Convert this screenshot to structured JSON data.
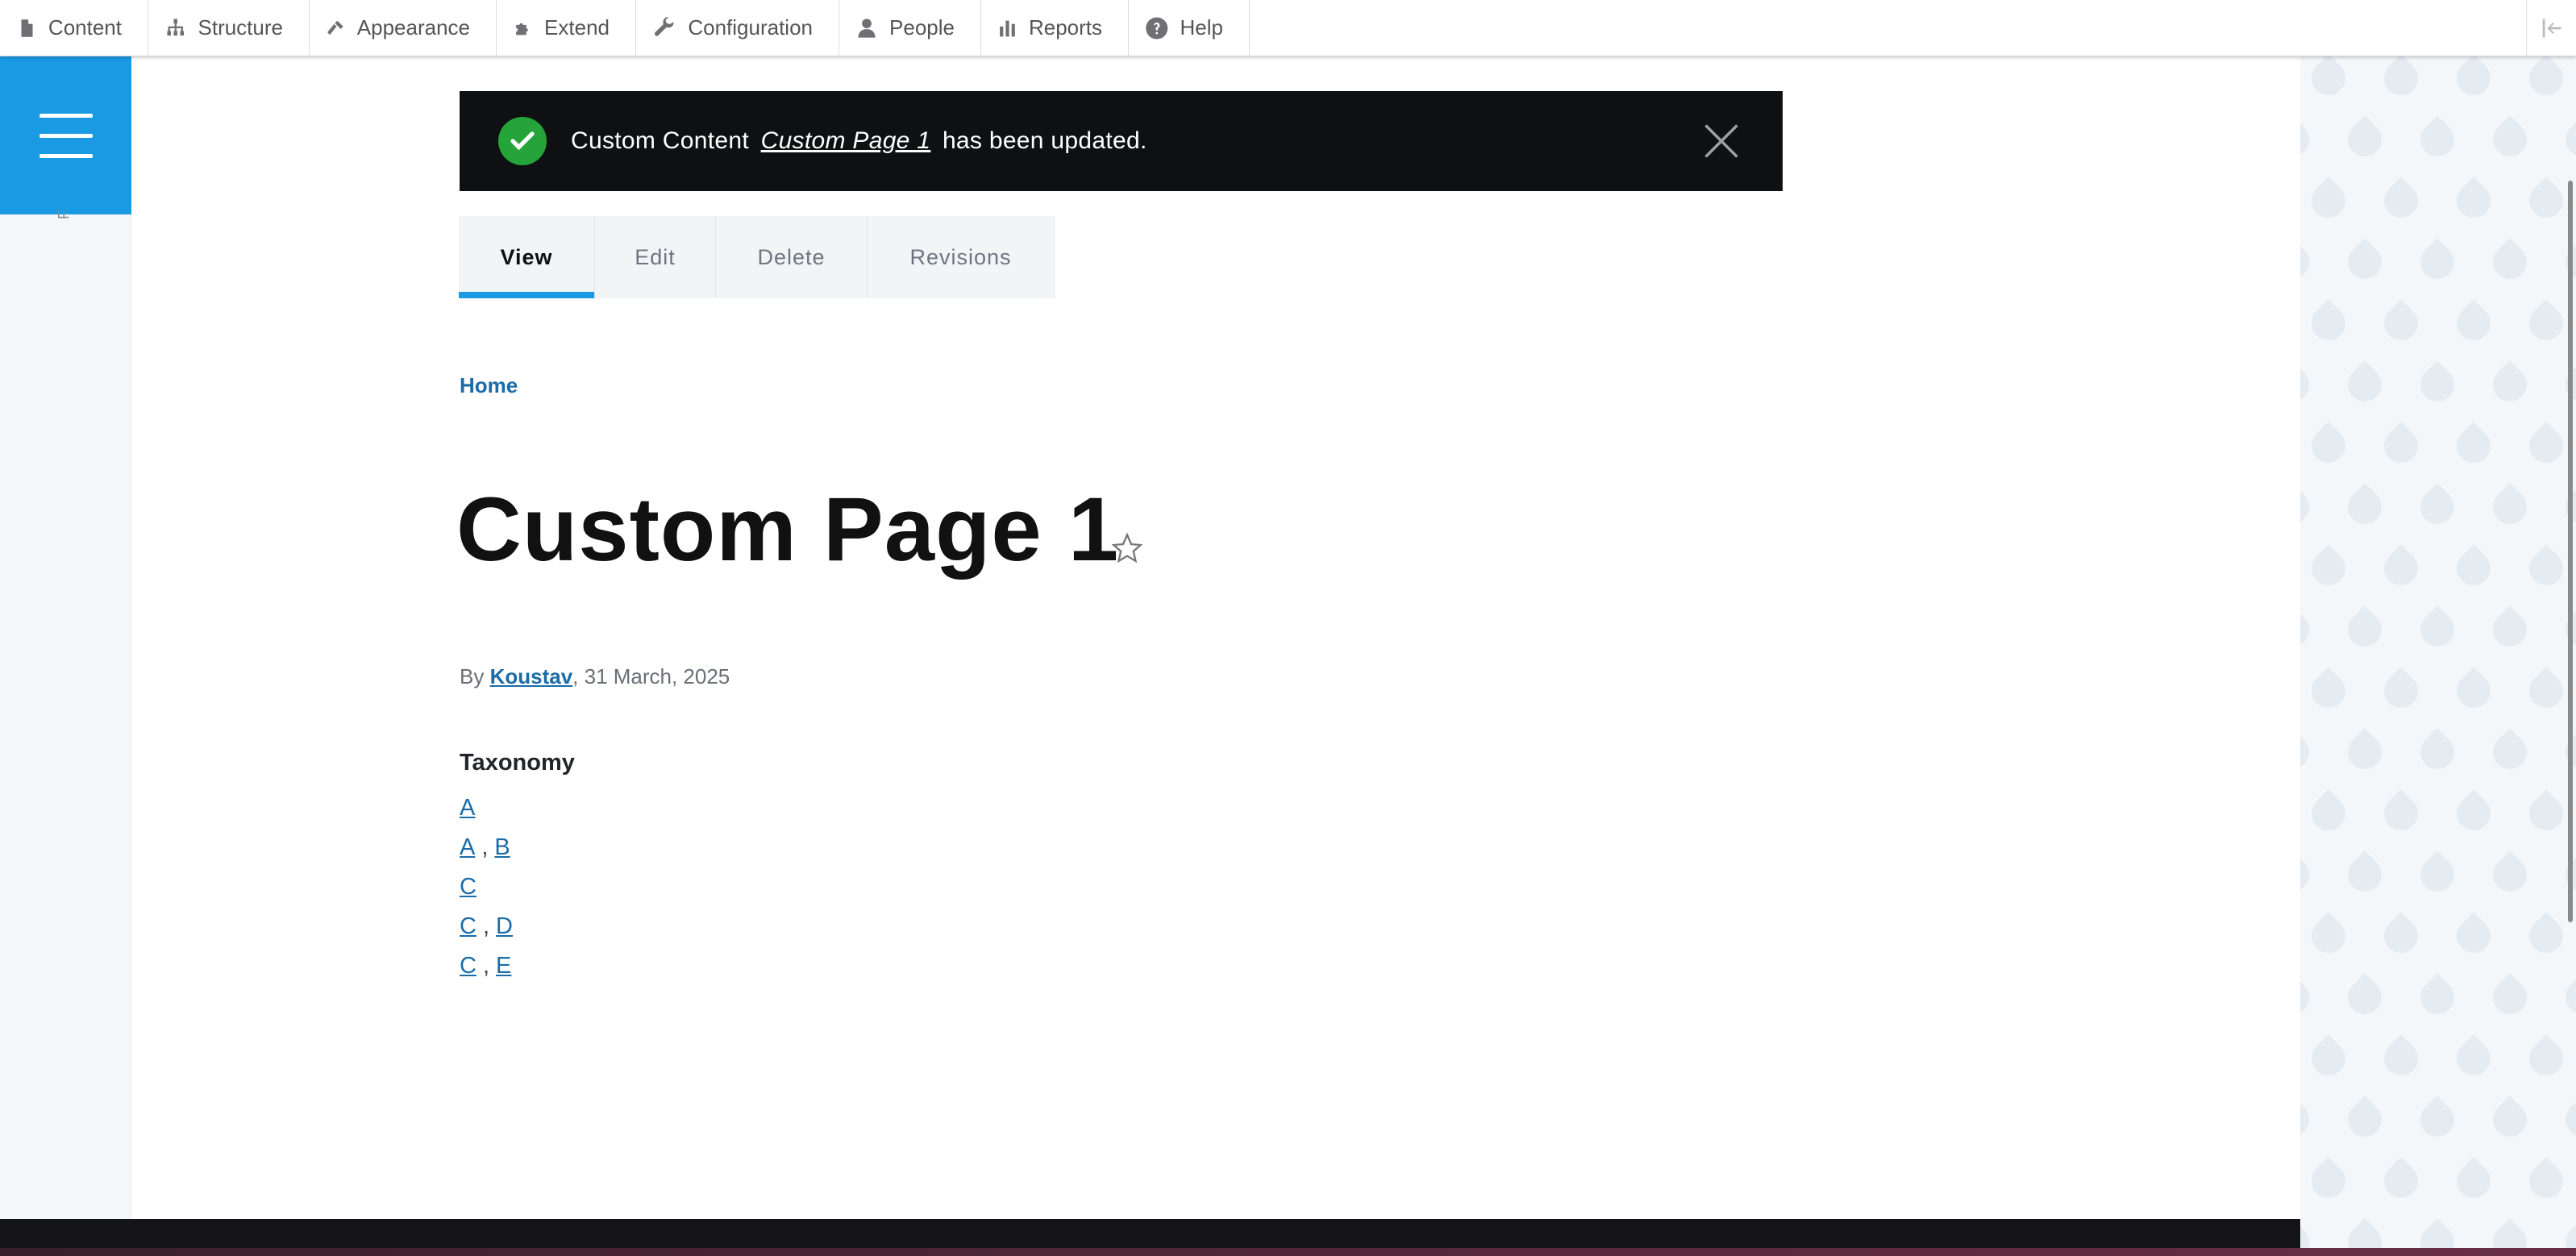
{
  "toolbar": {
    "items": [
      {
        "label": "Content",
        "icon": "file-icon"
      },
      {
        "label": "Structure",
        "icon": "sitemap-icon"
      },
      {
        "label": "Appearance",
        "icon": "paintbrush-icon"
      },
      {
        "label": "Extend",
        "icon": "puzzle-icon"
      },
      {
        "label": "Configuration",
        "icon": "wrench-icon"
      },
      {
        "label": "People",
        "icon": "person-icon"
      },
      {
        "label": "Reports",
        "icon": "bar-chart-icon"
      },
      {
        "label": "Help",
        "icon": "question-icon"
      }
    ]
  },
  "sidebar": {
    "rotated_letter": "F"
  },
  "message": {
    "prefix": "Custom Content",
    "link": "Custom Page 1",
    "suffix": "has been updated."
  },
  "tabs": [
    {
      "label": "View",
      "active": true
    },
    {
      "label": "Edit",
      "active": false
    },
    {
      "label": "Delete",
      "active": false
    },
    {
      "label": "Revisions",
      "active": false
    }
  ],
  "breadcrumb": {
    "home": "Home"
  },
  "page": {
    "title": "Custom Page 1",
    "meta_by": "By",
    "author": "Koustav",
    "date": ", 31 March, 2025"
  },
  "taxonomy": {
    "label": "Taxonomy",
    "rows": [
      {
        "terms": [
          "A"
        ]
      },
      {
        "terms": [
          "A",
          "B"
        ]
      },
      {
        "terms": [
          "C"
        ]
      },
      {
        "terms": [
          "C",
          "D"
        ]
      },
      {
        "terms": [
          "C",
          "E"
        ]
      }
    ],
    "separator": ","
  },
  "colors": {
    "accent": "#1b9ae4",
    "link": "#1a6ca8",
    "status_bg": "#0f1012",
    "success": "#25a43a"
  }
}
